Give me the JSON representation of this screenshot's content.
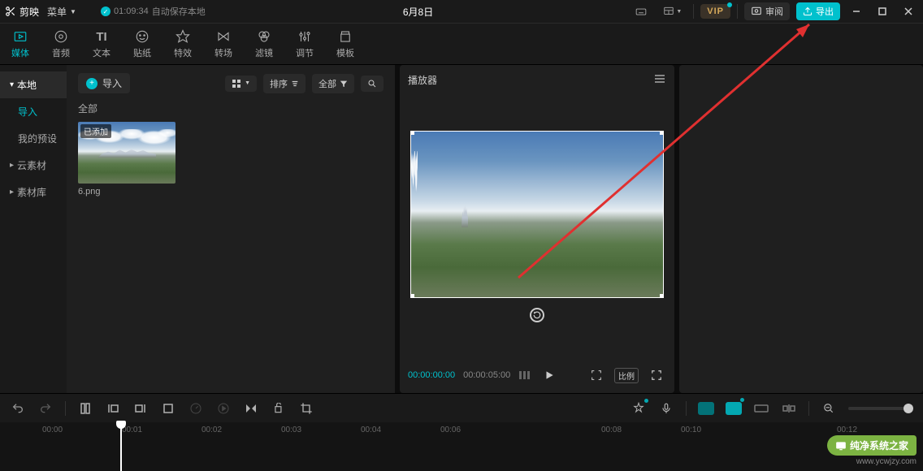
{
  "titlebar": {
    "app_name": "剪映",
    "menu_label": "菜单",
    "autosave_time": "01:09:34",
    "autosave_label": "自动保存本地",
    "project_title": "6月8日",
    "vip_label": "VIP",
    "review_label": "审阅",
    "export_label": "导出"
  },
  "toolbar": [
    {
      "label": "媒体",
      "active": true
    },
    {
      "label": "音频"
    },
    {
      "label": "文本"
    },
    {
      "label": "贴纸"
    },
    {
      "label": "特效"
    },
    {
      "label": "转场"
    },
    {
      "label": "滤镜"
    },
    {
      "label": "调节"
    },
    {
      "label": "模板"
    }
  ],
  "sidebar": [
    {
      "label": "本地",
      "kind": "bullet-open",
      "active": true
    },
    {
      "label": "导入",
      "kind": "plain",
      "active": true
    },
    {
      "label": "我的预设",
      "kind": "plain"
    },
    {
      "label": "云素材",
      "kind": "bullet"
    },
    {
      "label": "素材库",
      "kind": "bullet"
    }
  ],
  "assets": {
    "import_label": "导入",
    "sort_label": "排序",
    "filter_label": "全部",
    "section_label": "全部",
    "thumb_tag": "已添加",
    "thumb_name": "6.png"
  },
  "player": {
    "title": "播放器",
    "time_current": "00:00:00:00",
    "time_total": "00:00:05:00",
    "ratio_label": "比例"
  },
  "timeline": {
    "ticks": [
      "00:00",
      "00:01",
      "00:02",
      "00:03",
      "00:04",
      "00:06",
      "00:08",
      "00:10",
      "00:12"
    ]
  },
  "watermark": {
    "brand": "纯净系统之家",
    "url": "www.ycwjzy.com"
  }
}
